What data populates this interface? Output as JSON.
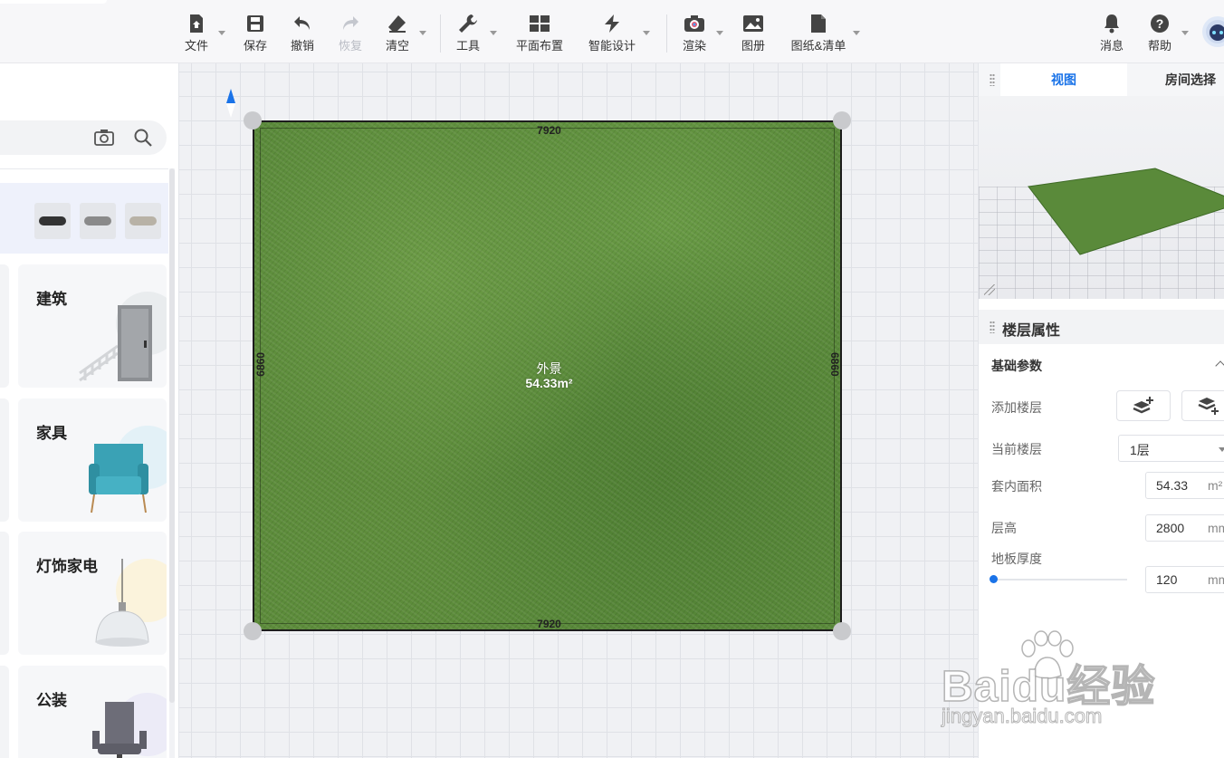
{
  "toolbar": {
    "items": [
      {
        "label": "文件",
        "icon": "home-file-icon",
        "caret": true
      },
      {
        "label": "保存",
        "icon": "save-icon"
      },
      {
        "label": "撤销",
        "icon": "undo-icon"
      },
      {
        "label": "恢复",
        "icon": "redo-icon",
        "disabled": true
      },
      {
        "label": "清空",
        "icon": "eraser-icon",
        "caret": true
      },
      {
        "label": "工具",
        "icon": "wrench-icon",
        "caret": true
      },
      {
        "label": "平面布置",
        "icon": "layout-icon"
      },
      {
        "label": "智能设计",
        "icon": "lightning-icon",
        "caret": true
      },
      {
        "label": "渲染",
        "icon": "camera-render-icon",
        "caret": true
      },
      {
        "label": "图册",
        "icon": "album-icon"
      },
      {
        "label": "图纸&清单",
        "icon": "document-icon",
        "caret": true
      },
      {
        "label": "消息",
        "icon": "bell-icon"
      },
      {
        "label": "帮助",
        "icon": "help-icon",
        "caret": true
      }
    ]
  },
  "left_panel": {
    "categories": [
      {
        "label": "建筑"
      },
      {
        "label": "家具"
      },
      {
        "label": "灯饰家电"
      },
      {
        "label": "公装"
      }
    ]
  },
  "canvas": {
    "room": {
      "name": "外景",
      "area": "54.33m²",
      "top_dim": "7920",
      "bottom_dim": "7920",
      "left_dim": "6860",
      "right_dim": "6860"
    }
  },
  "right_panel": {
    "tabs": [
      {
        "label": "视图",
        "active": true
      },
      {
        "label": "房间选择",
        "active": false
      }
    ],
    "floor_props": {
      "title": "楼层属性",
      "section": "基础参数",
      "add_floor_label": "添加楼层",
      "current_floor_label": "当前楼层",
      "current_floor_value": "1层",
      "inner_area_label": "套内面积",
      "inner_area_value": "54.33",
      "inner_area_unit": "m²",
      "height_label": "层高",
      "height_value": "2800",
      "height_unit": "mm",
      "slab_label": "地板厚度",
      "slab_value": "120",
      "slab_unit": "mm"
    }
  },
  "watermark": {
    "brand": "Baidu经验",
    "url": "jingyan.baidu.com"
  },
  "colors": {
    "accent": "#1a73e8",
    "grass": "#5a8a3a"
  }
}
